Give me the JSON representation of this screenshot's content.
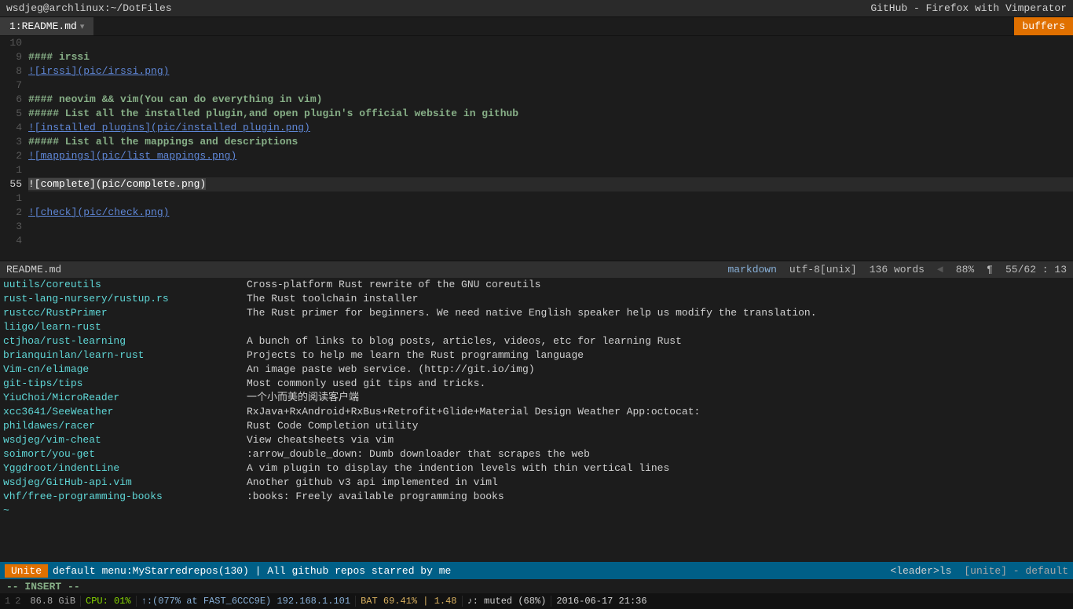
{
  "titlebar": {
    "left": "wsdjeg@archlinux:~/DotFiles",
    "right": "GitHub - Firefox with Vimperator"
  },
  "tabbar": {
    "active_tab": "1:README.md",
    "buffers_label": "buffers"
  },
  "editor": {
    "lines": [
      {
        "num": "10",
        "content": "",
        "type": "blank"
      },
      {
        "num": "9",
        "content": "#### irssi",
        "type": "heading"
      },
      {
        "num": "8",
        "content": "![irssi](pic/irssi.png)",
        "type": "link"
      },
      {
        "num": "7",
        "content": "",
        "type": "blank"
      },
      {
        "num": "6",
        "content": "#### neovim && vim(You can do everything in vim)",
        "type": "heading"
      },
      {
        "num": "5",
        "content": "##### List all the installed plugin,and open plugin's official website in github",
        "type": "heading"
      },
      {
        "num": "4",
        "content": "![installed_plugins](pic/installed_plugin.png)",
        "type": "link"
      },
      {
        "num": "3",
        "content": "##### List all the mappings and descriptions",
        "type": "heading"
      },
      {
        "num": "2",
        "content": "![mappings](pic/list_mappings.png)",
        "type": "link"
      },
      {
        "num": "1",
        "content": "",
        "type": "blank"
      },
      {
        "num": "55",
        "content": "![complete](pic/complete.png)",
        "type": "link_highlight",
        "current": true
      },
      {
        "num": "1",
        "content": "",
        "type": "blank"
      },
      {
        "num": "2",
        "content": "![check](pic/check.png)",
        "type": "link"
      },
      {
        "num": "3",
        "content": "",
        "type": "blank"
      },
      {
        "num": "4",
        "content": "",
        "type": "blank"
      }
    ]
  },
  "statusline": {
    "filename": "README.md",
    "filetype": "markdown",
    "encoding": "utf-8[unix]",
    "words": "136 words",
    "arrows": "◄ ►",
    "scroll": "88%",
    "symbol": "¶",
    "position": "55/62 : 13"
  },
  "unite": {
    "rows": [
      {
        "col1": "uutils/coreutils",
        "col2": "Cross-platform Rust rewrite of the GNU coreutils"
      },
      {
        "col1": "rust-lang-nursery/rustup.rs",
        "col2": "The Rust toolchain installer"
      },
      {
        "col1": "rustcc/RustPrimer",
        "col2": "The Rust primer for beginners. We need native English speaker help us modify the translation."
      },
      {
        "col1": "liigo/learn-rust",
        "col2": ""
      },
      {
        "col1": "ctjhoa/rust-learning",
        "col2": "A bunch of links to blog posts, articles, videos, etc for learning Rust"
      },
      {
        "col1": "brianquinlan/learn-rust",
        "col2": "Projects to help me learn the Rust programming language"
      },
      {
        "col1": "Vim-cn/elimage",
        "col2": "An image paste web service. (http://git.io/img)"
      },
      {
        "col1": "git-tips/tips",
        "col2": "Most commonly used git tips and tricks."
      },
      {
        "col1": "YiuChoi/MicroReader",
        "col2": "一个小而美的阅读客户端"
      },
      {
        "col1": "xcc3641/SeeWeather",
        "col2": "RxJava+RxAndroid+RxBus+Retrofit+Glide+Material Design Weather App:octocat:"
      },
      {
        "col1": "phildawes/racer",
        "col2": "Rust Code Completion utility"
      },
      {
        "col1": "wsdjeg/vim-cheat",
        "col2": "View cheatsheets via vim"
      },
      {
        "col1": "soimort/you-get",
        "col2": ":arrow_double_down: Dumb downloader that scrapes the web"
      },
      {
        "col1": "Yggdroot/indentLine",
        "col2": "A vim plugin to display the indention levels with thin vertical lines"
      },
      {
        "col1": "wsdjeg/GitHub-api.vim",
        "col2": "Another github v3 api implemented in viml"
      },
      {
        "col1": "vhf/free-programming-books",
        "col2": ":books: Freely available programming books"
      },
      {
        "col1": "~",
        "col2": ""
      }
    ]
  },
  "unite_statusbar": {
    "tab_label": "Unite",
    "default_label": "default",
    "menu_label": "menu:MyStarredrepos(130) | All github repos starred by me",
    "right_label": "<leader>ls",
    "far_right": "[unite] - default"
  },
  "insert_bar": {
    "text": "-- INSERT --"
  },
  "systembar": {
    "workspace_num": "1",
    "workspace_num2": "2",
    "disk": "86.8 GiB",
    "cpu": "CPU: 01%",
    "network": "↑:(077% at FAST_6CCC9E) 192.168.1.101",
    "battery": "BAT 69.41%",
    "battery_val": "1.48",
    "volume": "♪: muted (68%)",
    "datetime": "2016-06-17 21:36"
  }
}
